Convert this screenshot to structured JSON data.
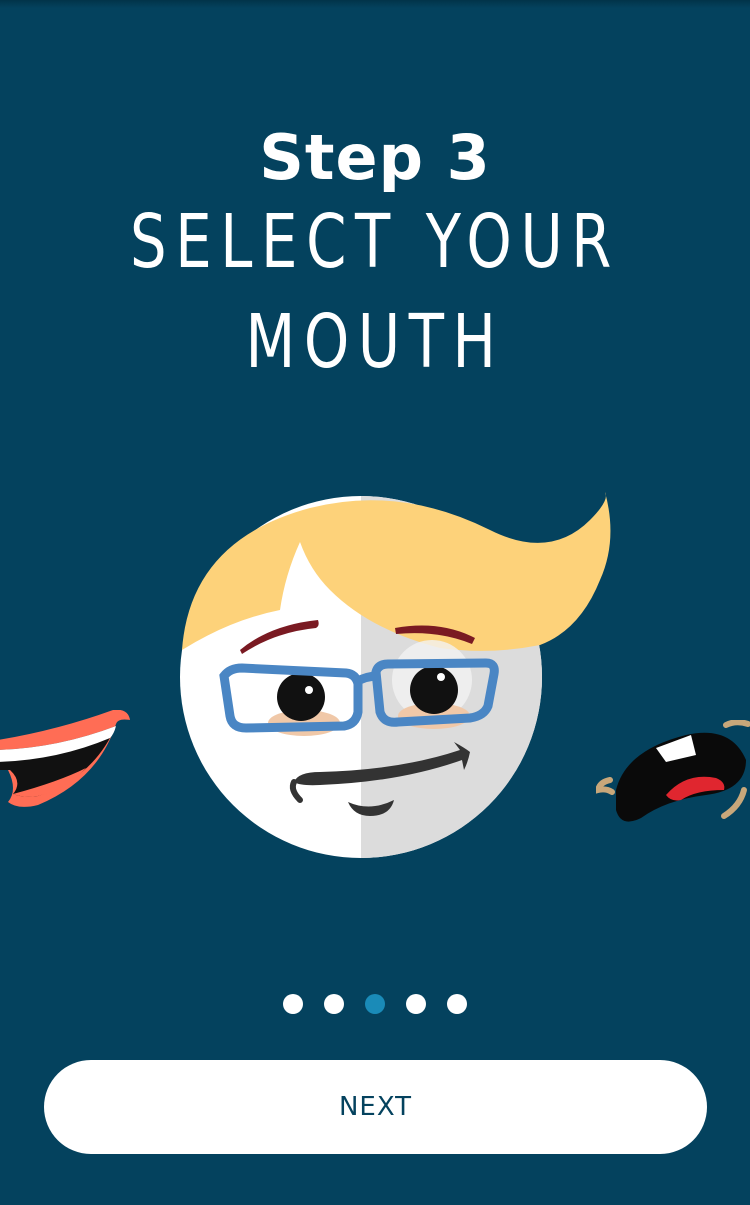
{
  "header": {
    "step": "Step 3",
    "instruction": "SELECT YOUR MOUTH"
  },
  "carousel": {
    "items": [
      "smile-mouth-option",
      "smirk-face-preview",
      "crying-mouth-option"
    ],
    "selected_index": 1
  },
  "pager": {
    "count": 5,
    "active_index": 2
  },
  "footer": {
    "next_label": "NEXT"
  },
  "colors": {
    "background": "#04425e",
    "accent": "#1a8bb8",
    "hair": "#fdd27a",
    "glasses": "#4a86c4"
  }
}
